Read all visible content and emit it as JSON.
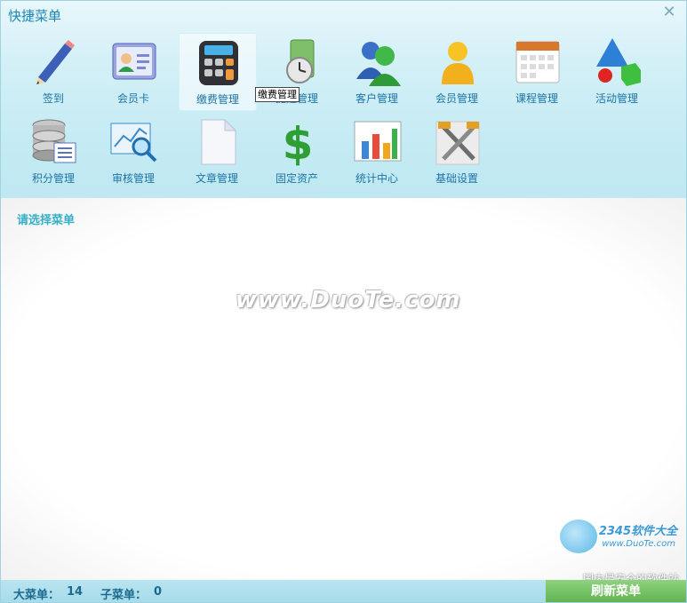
{
  "window": {
    "title": "快捷菜单",
    "close_glyph": "✕"
  },
  "menu": [
    {
      "label": "签到",
      "icon": "pencil-icon"
    },
    {
      "label": "会员卡",
      "icon": "member-card-icon"
    },
    {
      "label": "缴费管理",
      "icon": "calculator-icon",
      "selected": true
    },
    {
      "label": "提醒管理",
      "icon": "clock-icon"
    },
    {
      "label": "客户管理",
      "icon": "users-icon"
    },
    {
      "label": "会员管理",
      "icon": "member-icon"
    },
    {
      "label": "课程管理",
      "icon": "calendar-icon"
    },
    {
      "label": "活动管理",
      "icon": "shapes-icon"
    },
    {
      "label": "积分管理",
      "icon": "database-icon"
    },
    {
      "label": "审核管理",
      "icon": "magnifier-icon"
    },
    {
      "label": "文章管理",
      "icon": "document-icon"
    },
    {
      "label": "固定资产",
      "icon": "dollar-icon"
    },
    {
      "label": "统计中心",
      "icon": "bar-chart-icon"
    },
    {
      "label": "基础设置",
      "icon": "tools-icon"
    }
  ],
  "tooltip": "缴费管理",
  "content": {
    "prompt": "请选择菜单",
    "watermark": "www.DuoTe.com"
  },
  "logo": {
    "brand": "2345软件大全",
    "site": "www.DuoTe.com"
  },
  "status": {
    "big_menu_label": "大菜单：",
    "big_menu_count": "14",
    "sub_menu_label": "子菜单：",
    "sub_menu_count": "0",
    "slogan": "国内最安全的软件站",
    "refresh_label": "刷新菜单"
  }
}
